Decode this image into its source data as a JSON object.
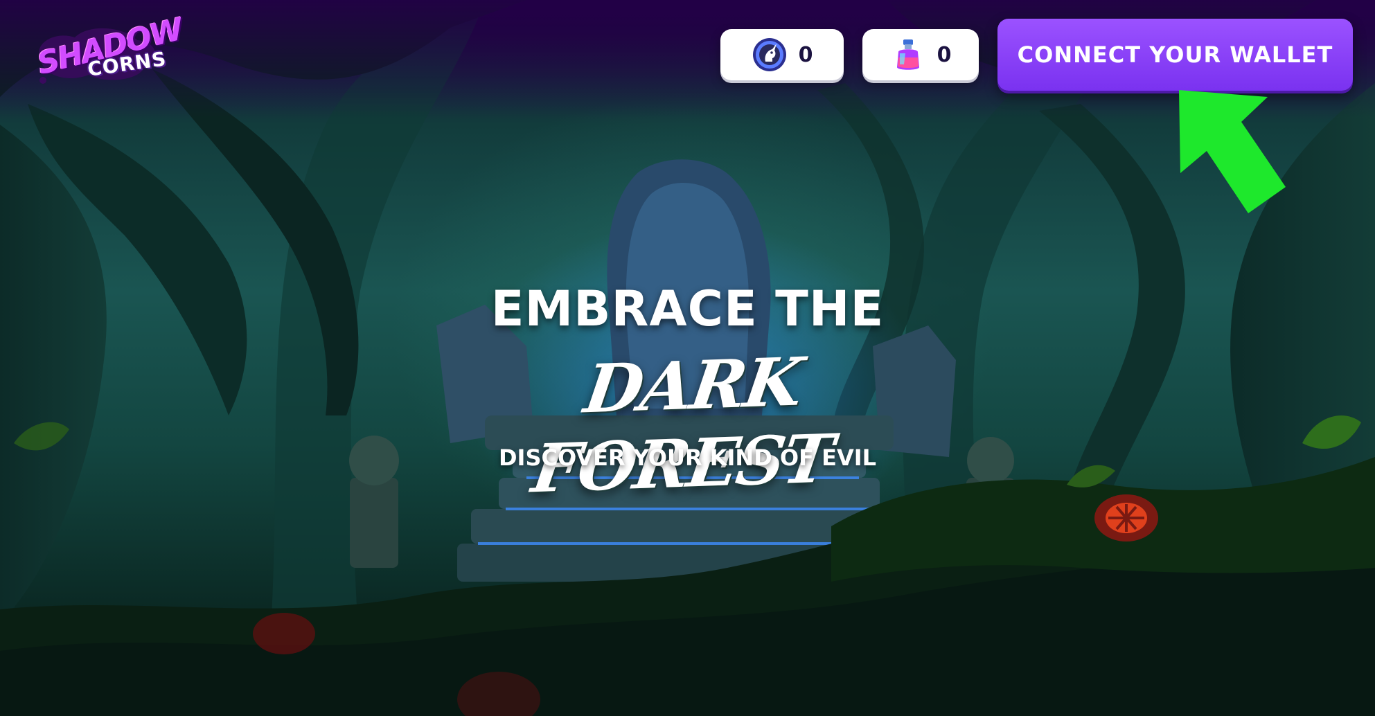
{
  "brand": {
    "logo_line1": "SHADOW",
    "logo_line2": "CORNS"
  },
  "header": {
    "balances": [
      {
        "icon": "unicorn-token-icon",
        "value": "0"
      },
      {
        "icon": "potion-bottle-icon",
        "value": "0"
      }
    ],
    "connect_label": "CONNECT YOUR WALLET"
  },
  "hero": {
    "line1": "EMBRACE THE",
    "line2": "DARK FOREST",
    "line3": "DISCOVER YOUR KIND OF EVIL"
  },
  "annotation": {
    "arrow_color": "#1ee82c",
    "arrow_target": "connect-wallet-button"
  },
  "colors": {
    "accent": "#8a42fb",
    "logo_purple": "#d24cff",
    "chip_bg": "#ffffff",
    "chip_text": "#1b1240"
  }
}
